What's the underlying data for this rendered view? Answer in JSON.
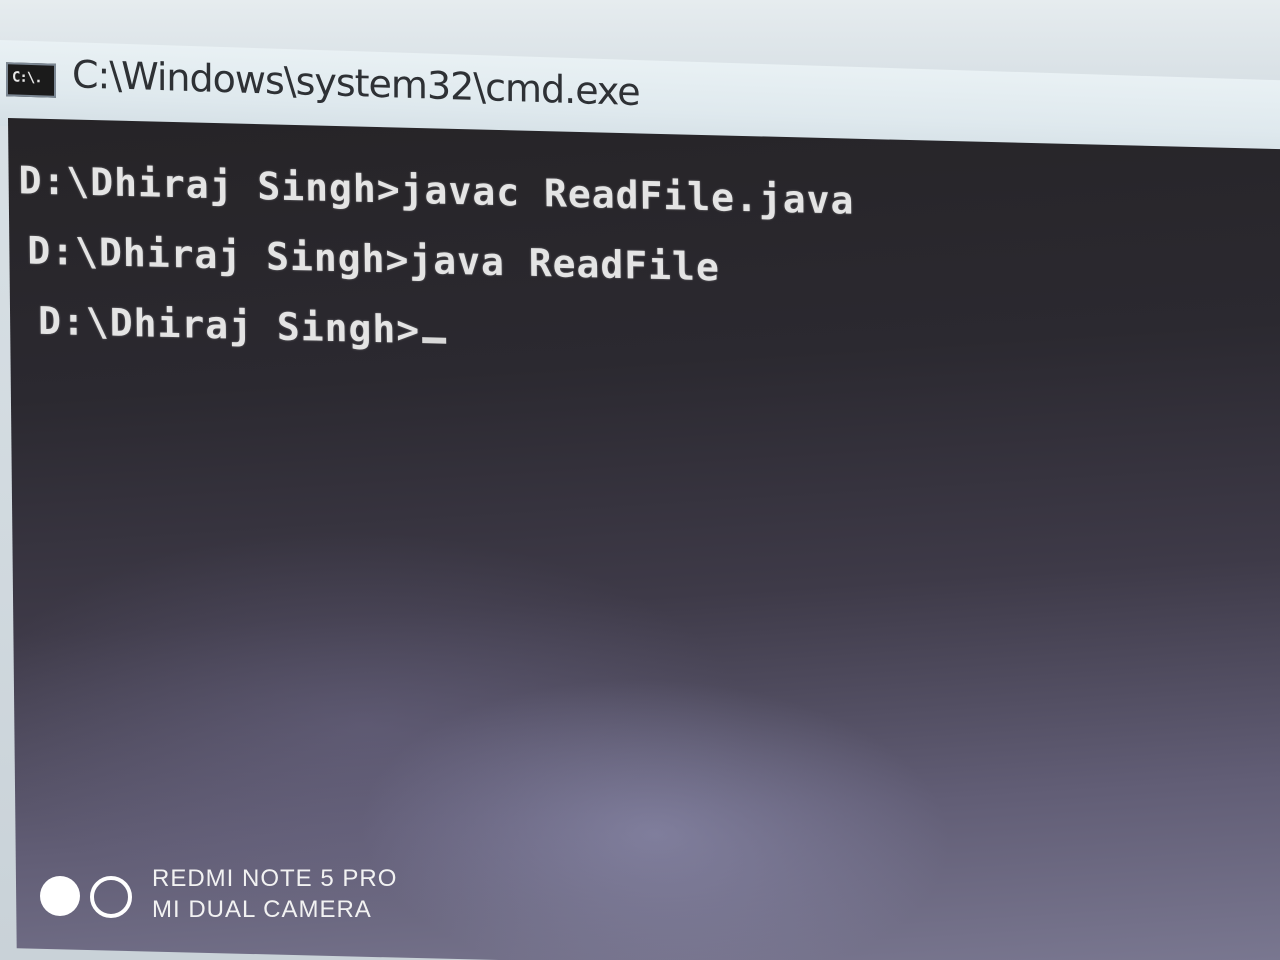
{
  "window": {
    "title": "C:\\Windows\\system32\\cmd.exe",
    "icon": "cmd-icon",
    "icon_text": "C:\\."
  },
  "console": {
    "lines": [
      "D:\\Dhiraj Singh>javac ReadFile.java",
      "D:\\Dhiraj Singh>java ReadFile",
      "D:\\Dhiraj Singh>"
    ],
    "text_color": "#e4e4e4",
    "background_color": "#2b2930"
  },
  "watermark": {
    "line1": "REDMI NOTE 5 PRO",
    "line2": "MI DUAL CAMERA"
  }
}
